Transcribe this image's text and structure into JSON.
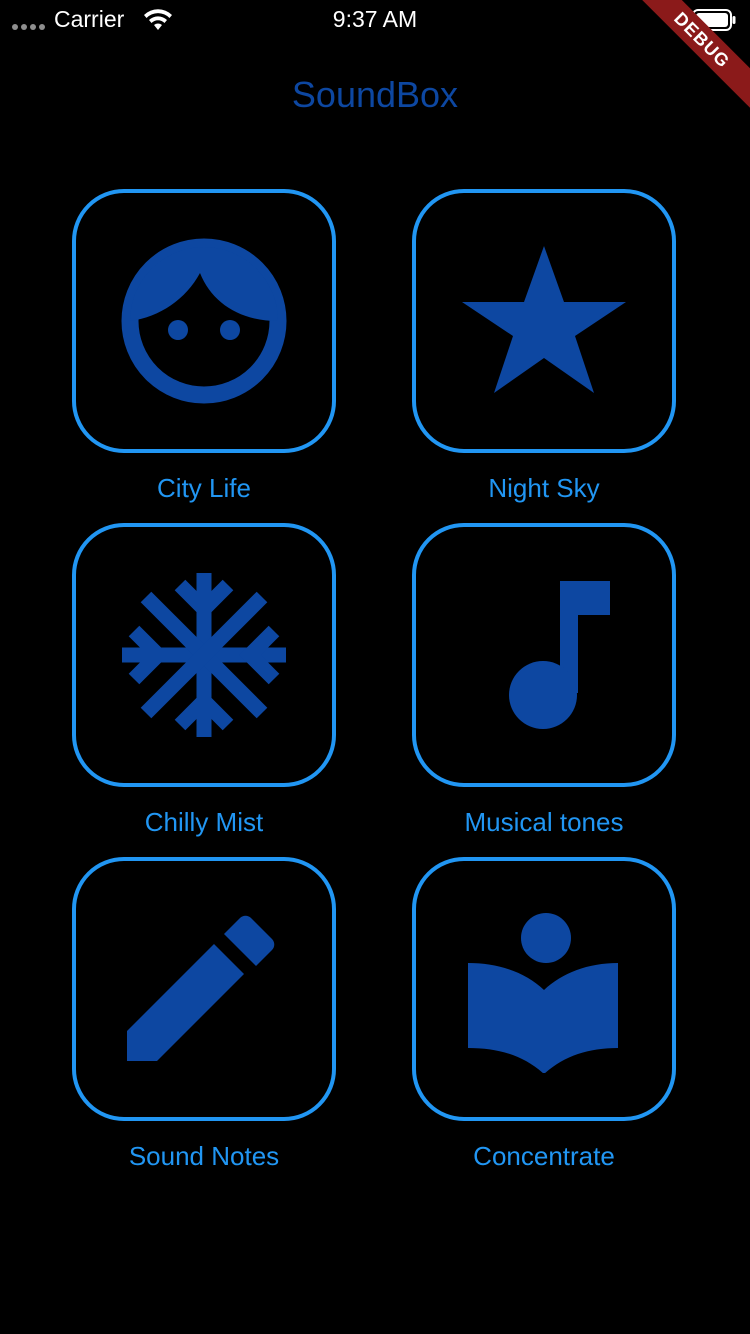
{
  "status_bar": {
    "carrier": "Carrier",
    "time": "9:37 AM",
    "icons": [
      "signal-dots-icon",
      "wifi-icon",
      "battery-icon"
    ]
  },
  "debug_banner": "DEBUG",
  "app": {
    "title": "SoundBox"
  },
  "colors": {
    "background": "#000000",
    "title": "#0d47a1",
    "accent": "#2196f3",
    "icon_fill": "#0d47a1",
    "debug_ribbon": "#8b1a1a"
  },
  "tiles": [
    {
      "label": "City Life",
      "icon": "face-icon"
    },
    {
      "label": "Night Sky",
      "icon": "star-icon"
    },
    {
      "label": "Chilly Mist",
      "icon": "snowflake-icon"
    },
    {
      "label": "Musical tones",
      "icon": "music-note-icon"
    },
    {
      "label": "Sound Notes",
      "icon": "pencil-icon"
    },
    {
      "label": "Concentrate",
      "icon": "reading-book-icon"
    }
  ]
}
